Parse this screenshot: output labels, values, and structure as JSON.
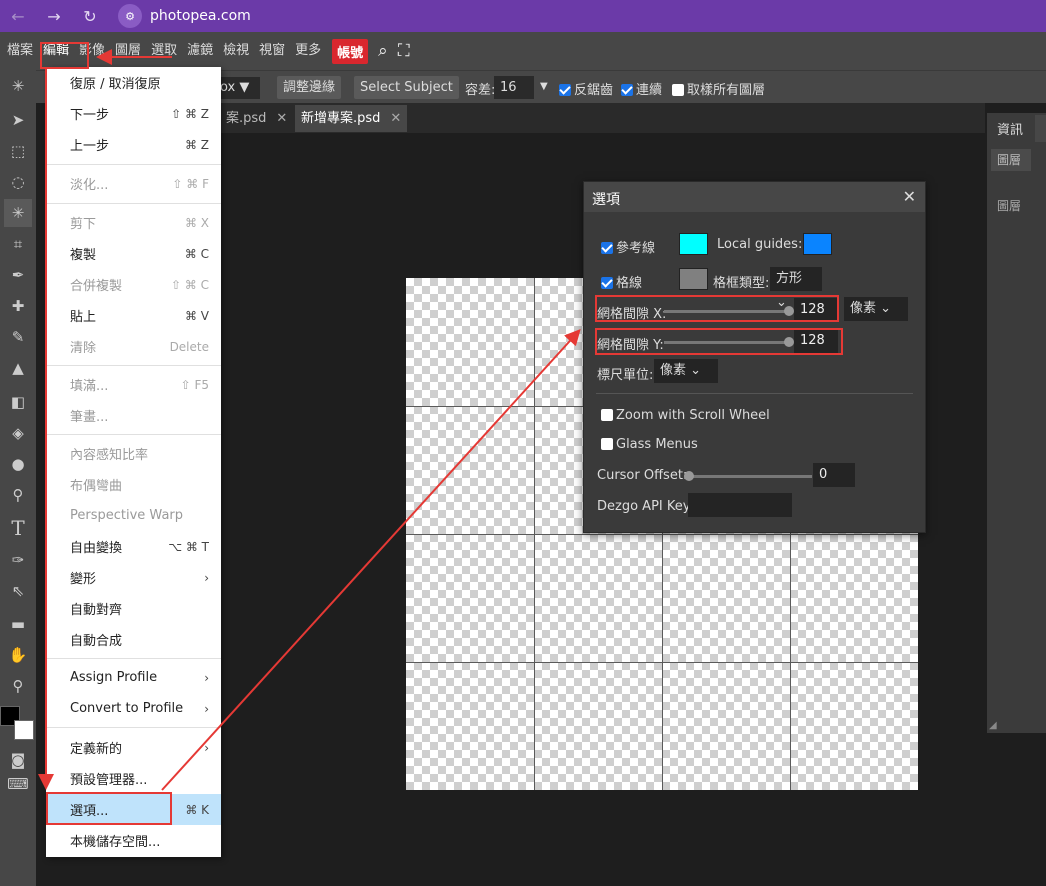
{
  "browser": {
    "back_label": "←",
    "forward_label": "→",
    "reload_label": "↻",
    "url": "photopea.com",
    "site_icon_label": "⚙"
  },
  "menubar": {
    "items": [
      "檔案",
      "編輯",
      "影像",
      "圖層",
      "選取",
      "濾鏡",
      "檢視",
      "視窗",
      "更多"
    ],
    "account": "帳號",
    "search_glyph": "⌕",
    "fullscreen_glyph": "⛶"
  },
  "options_bar": {
    "partial_select": "ox",
    "refine_edge": "調整邊緣",
    "select_subject": "Select Subject",
    "tolerance_label": "容差:",
    "tolerance_value": "16",
    "anti_alias": "反鋸齒",
    "contiguous": "連續",
    "sample_all": "取樣所有圖層"
  },
  "tabs": [
    {
      "label": "案.psd",
      "active": false
    },
    {
      "label": "新增專案.psd",
      "active": true
    }
  ],
  "tab_close_glyph": "✕",
  "right_panel": {
    "tab": "資訊",
    "subtab": "圖層",
    "layers_label": "圖層"
  },
  "edit_menu": {
    "items": [
      {
        "label": "復原 / 取消復原",
        "shortcut": "",
        "disabled": false
      },
      {
        "label": "下一步",
        "shortcut": "⇧ ⌘ Z",
        "disabled": false
      },
      {
        "label": "上一步",
        "shortcut": "⌘ Z",
        "disabled": false
      },
      {
        "label": "淡化...",
        "shortcut": "⇧ ⌘ F",
        "disabled": true
      },
      {
        "label": "剪下",
        "shortcut": "⌘ X",
        "disabled": true
      },
      {
        "label": "複製",
        "shortcut": "⌘ C",
        "disabled": false
      },
      {
        "label": "合併複製",
        "shortcut": "⇧ ⌘ C",
        "disabled": true
      },
      {
        "label": "貼上",
        "shortcut": "⌘ V",
        "disabled": false
      },
      {
        "label": "清除",
        "shortcut": "Delete",
        "disabled": true
      },
      {
        "label": "填滿...",
        "shortcut": "⇧ F5",
        "disabled": true
      },
      {
        "label": "筆畫...",
        "shortcut": "",
        "disabled": true
      },
      {
        "label": "內容感知比率",
        "shortcut": "",
        "disabled": true
      },
      {
        "label": "布偶彎曲",
        "shortcut": "",
        "disabled": true
      },
      {
        "label": "Perspective Warp",
        "shortcut": "",
        "disabled": true
      },
      {
        "label": "自由變換",
        "shortcut": "⌥ ⌘ T",
        "disabled": false
      },
      {
        "label": "變形",
        "shortcut": "›",
        "disabled": false
      },
      {
        "label": "自動對齊",
        "shortcut": "",
        "disabled": false
      },
      {
        "label": "自動合成",
        "shortcut": "",
        "disabled": false
      },
      {
        "label": "Assign Profile",
        "shortcut": "›",
        "disabled": false
      },
      {
        "label": "Convert to Profile",
        "shortcut": "›",
        "disabled": false
      },
      {
        "label": "定義新的",
        "shortcut": "›",
        "disabled": false
      },
      {
        "label": "預設管理器...",
        "shortcut": "",
        "disabled": false
      },
      {
        "label": "選項...",
        "shortcut": "⌘ K",
        "disabled": false,
        "selected": true
      },
      {
        "label": "本機儲存空間...",
        "shortcut": "",
        "disabled": false
      }
    ]
  },
  "dialog": {
    "title": "選項",
    "close_glyph": "✕",
    "guides_label": "參考線",
    "guides_color": "#00ffff",
    "local_guides_label": "Local guides:",
    "local_guides_color": "#0a84ff",
    "grid_label": "格線",
    "grid_color": "#808080",
    "grid_type_label": "格框類型:",
    "grid_type_value": "方形",
    "spacing_x_label": "網格間隙 X:",
    "spacing_x_value": "128",
    "spacing_unit": "像素",
    "spacing_y_label": "網格間隙 Y:",
    "spacing_y_value": "128",
    "ruler_unit_label": "標尺單位:",
    "ruler_unit_value": "像素",
    "zoom_scroll_label": "Zoom with Scroll Wheel",
    "glass_menus_label": "Glass Menus",
    "cursor_offset_label": "Cursor Offset:",
    "cursor_offset_value": "0",
    "dezgo_label": "Dezgo API Key:",
    "dezgo_value": ""
  },
  "colors": {
    "accent_red": "#d9272e",
    "browser_purple": "#6b3aa8",
    "annotation_red": "#e53935"
  }
}
